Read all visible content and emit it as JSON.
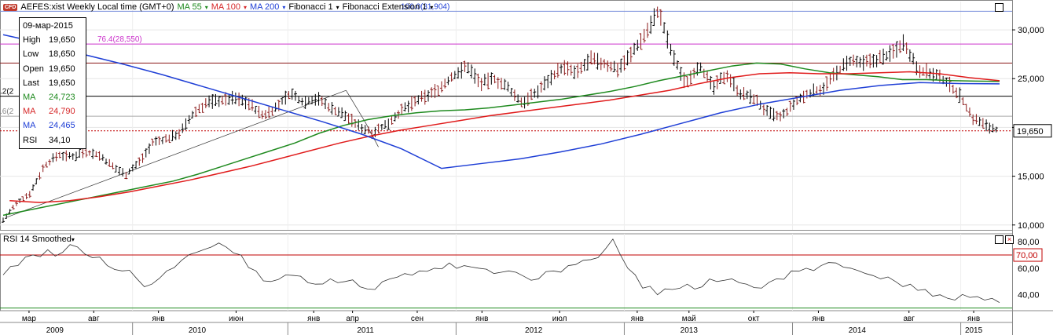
{
  "header": {
    "symbol_label": "AEFES:xist Weekly Local time (GMT+0)",
    "badge": "CFD",
    "ma1_label": "MA 55",
    "ma2_label": "MA 100",
    "ma3_label": "MA 200",
    "fib_label": "Fibonacci 1",
    "fibext_label": "Fibonacci Extension 1",
    "dropdown_glyph": "▾"
  },
  "info_box": {
    "date": "09-мар-2015",
    "rows": [
      {
        "k": "High",
        "v": "19,650",
        "color": "#000000"
      },
      {
        "k": "Low",
        "v": "18,650",
        "color": "#000000"
      },
      {
        "k": "Open",
        "v": "19,650",
        "color": "#000000"
      },
      {
        "k": "Last",
        "v": "19,650",
        "color": "#000000"
      },
      {
        "k": "MA",
        "v": "24,723",
        "color": "#1f8a1f"
      },
      {
        "k": "MA",
        "v": "24,790",
        "color": "#d62728"
      },
      {
        "k": "MA",
        "v": "24,465",
        "color": "#1f3fd6"
      },
      {
        "k": "RSI",
        "v": "34,10",
        "color": "#000000"
      }
    ]
  },
  "rsi_header": "RSI 14 Smoothed",
  "chart_data": {
    "type": "ohlc",
    "price_axis": {
      "ticks": [
        "10,000",
        "15,000",
        "20,000",
        "25,000",
        "30,000"
      ],
      "tick_values": [
        10000,
        15000,
        20000,
        25000,
        30000
      ],
      "range": [
        9500,
        32900
      ]
    },
    "last_price_label": "19,650",
    "last_price": 19650,
    "fib_labels": [
      {
        "text": "100.0(31,904)",
        "value": 31904,
        "color": "#1f3fd6"
      },
      {
        "text": "76.4(28,550)",
        "value": 28550,
        "color": "#cc33cc"
      },
      {
        "text": ".2(2",
        "value": 23200,
        "color": "#000000"
      },
      {
        "text": ".6(2",
        "value": 21150,
        "color": "#888888"
      }
    ],
    "fib_lines": [
      {
        "value": 31904,
        "color": "#7a8fdc"
      },
      {
        "value": 28550,
        "color": "#cc33cc"
      },
      {
        "value": 26600,
        "color": "#8b1a1a"
      },
      {
        "value": 23200,
        "color": "#000000"
      },
      {
        "value": 21150,
        "color": "#aaaaaa"
      },
      {
        "value": 19650,
        "color": "#c00000",
        "dashed": true
      }
    ],
    "x_month_labels": [
      {
        "t": 2,
        "label": "мар"
      },
      {
        "t": 7,
        "label": "авг"
      },
      {
        "t": 12,
        "label": "янв"
      },
      {
        "t": 18,
        "label": "июн"
      },
      {
        "t": 24,
        "label": "янв"
      },
      {
        "t": 27,
        "label": "апр"
      },
      {
        "t": 32,
        "label": "сен"
      },
      {
        "t": 37,
        "label": "янв"
      },
      {
        "t": 43,
        "label": "июл"
      },
      {
        "t": 49,
        "label": "янв"
      },
      {
        "t": 53,
        "label": "май"
      },
      {
        "t": 58,
        "label": "окт"
      },
      {
        "t": 63,
        "label": "янв"
      },
      {
        "t": 70,
        "label": "авг"
      },
      {
        "t": 75,
        "label": "янв"
      }
    ],
    "x_year_labels": [
      {
        "t": 4,
        "label": "2009"
      },
      {
        "t": 15,
        "label": "2010"
      },
      {
        "t": 28,
        "label": "2011"
      },
      {
        "t": 41,
        "label": "2012"
      },
      {
        "t": 53,
        "label": "2013"
      },
      {
        "t": 66,
        "label": "2014"
      },
      {
        "t": 75,
        "label": "2015"
      }
    ],
    "x_year_separators": [
      10,
      22,
      35,
      48,
      61,
      74
    ],
    "ohlc_close_monthly": [
      10.5,
      12.2,
      13.3,
      16.0,
      17.2,
      17.0,
      17.5,
      17.2,
      16.0,
      15.2,
      16.5,
      18.5,
      18.8,
      19.5,
      21.5,
      22.6,
      22.8,
      23.0,
      22.5,
      21.2,
      22.0,
      23.5,
      22.6,
      23.0,
      22.0,
      21.3,
      20.2,
      19.5,
      20.2,
      21.5,
      22.5,
      23.2,
      24.0,
      25.3,
      26.3,
      24.5,
      25.0,
      24.0,
      22.5,
      23.5,
      25.0,
      26.2,
      25.5,
      27.0,
      26.5,
      26.0,
      27.5,
      29.5,
      32.0,
      27.5,
      24.5,
      26.5,
      24.0,
      25.5,
      23.5,
      23.0,
      21.5,
      21.0,
      22.5,
      23.5,
      24.0,
      25.5,
      26.8,
      26.5,
      27.0,
      27.5,
      28.8,
      26.0,
      25.5,
      24.8,
      23.5,
      21.0,
      20.2,
      19.65
    ],
    "ma55": [
      11.0,
      11.5,
      12.0,
      12.5,
      13.0,
      13.5,
      14.0,
      14.5,
      15.2,
      16.0,
      16.8,
      17.6,
      18.4,
      19.4,
      20.2,
      20.8,
      21.2,
      21.5,
      21.7,
      21.8,
      22.0,
      22.3,
      22.6,
      22.9,
      23.3,
      23.7,
      24.2,
      24.8,
      25.3,
      25.8,
      26.3,
      26.6,
      26.5,
      26.0,
      25.6,
      25.4,
      25.2,
      24.9,
      24.9,
      24.8,
      24.75,
      24.72
    ],
    "ma100": [
      12.5,
      12.3,
      12.5,
      12.9,
      13.4,
      14.0,
      14.6,
      15.3,
      16.0,
      16.8,
      17.6,
      18.4,
      19.1,
      19.7,
      20.2,
      20.7,
      21.2,
      21.6,
      22.0,
      22.4,
      22.8,
      23.3,
      23.8,
      24.5,
      25.1,
      25.5,
      25.6,
      25.5,
      25.5,
      25.6,
      25.7,
      25.5,
      25.1,
      24.79
    ],
    "ma200": [
      29.5,
      28.6,
      27.5,
      26.5,
      25.4,
      24.2,
      23.0,
      21.8,
      20.6,
      19.3,
      17.8,
      15.8,
      16.3,
      16.8,
      17.5,
      18.3,
      19.3,
      20.4,
      21.5,
      22.4,
      23.1,
      23.8,
      24.3,
      24.6,
      24.5,
      24.465
    ],
    "rsi_axis": {
      "ticks": [
        "40,00",
        "60,00",
        "80,00"
      ],
      "tick_values": [
        40,
        60,
        80
      ],
      "range": [
        28,
        86
      ]
    },
    "rsi_levels": [
      {
        "label": "70,00",
        "value": 70,
        "color": "#c00000"
      },
      {
        "value": 30,
        "color": "#1f8a1f"
      }
    ],
    "rsi_series": [
      55,
      62,
      70,
      74,
      72,
      76,
      68,
      62,
      58,
      52,
      48,
      58,
      66,
      72,
      76,
      76,
      70,
      58,
      50,
      55,
      54,
      48,
      52,
      50,
      46,
      44,
      52,
      56,
      58,
      60,
      64,
      62,
      60,
      56,
      58,
      54,
      52,
      58,
      62,
      66,
      68,
      82,
      60,
      45,
      40,
      44,
      48,
      46,
      50,
      52,
      48,
      45,
      52,
      58,
      60,
      62,
      64,
      60,
      56,
      52,
      50,
      48,
      44,
      40,
      36,
      38,
      36,
      34.1
    ]
  }
}
